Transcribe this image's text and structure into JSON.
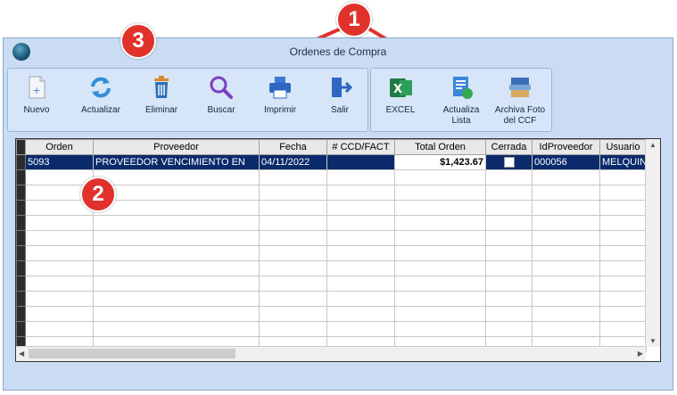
{
  "window": {
    "title": "Ordenes de Compra"
  },
  "toolbar": {
    "nuevo": "Nuevo",
    "actualizar": "Actualizar",
    "eliminar": "Eliminar",
    "buscar": "Buscar",
    "imprimir": "Imprimir",
    "salir": "Salir",
    "excel": "EXCEL",
    "actualiza_lista": [
      "Actualiza",
      "Lista"
    ],
    "archiva_foto": [
      "Archiva Foto",
      "del CCF"
    ]
  },
  "table": {
    "columns": [
      "Orden",
      "Proveedor",
      "Fecha",
      "# CCD/FACT",
      "Total Orden",
      "Cerrada",
      "IdProveedor",
      "Usuario"
    ],
    "rows": [
      {
        "orden": "5093",
        "proveedor": "PROVEEDOR VENCIMIENTO EN",
        "fecha": "04/11/2022",
        "ccd_fact": "",
        "total": "$1,423.67",
        "cerrada": false,
        "idproveedor": "000056",
        "usuario": "MELQUIN"
      }
    ]
  },
  "callouts": {
    "one": "1",
    "two": "2",
    "three": "3"
  },
  "colors": {
    "window_bg": "#c9dcf3",
    "selected_row": "#0b2a6b",
    "callout": "#e0322b"
  }
}
